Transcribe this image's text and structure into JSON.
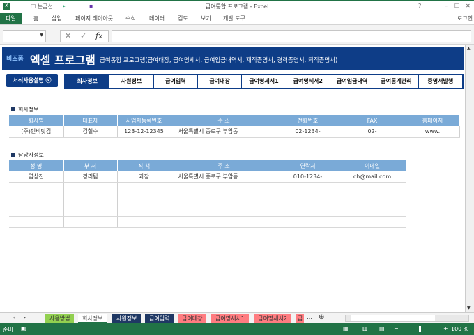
{
  "window": {
    "title": "급여통합 프로그램 - Excel",
    "gridlines_label": "눈금선",
    "help": "?",
    "minimize": "–",
    "maximize": "☐",
    "close": "✕"
  },
  "ribbon": {
    "tabs": [
      "파일",
      "홈",
      "삽입",
      "페이지 레이아웃",
      "수식",
      "데이터",
      "검토",
      "보기",
      "개발 도구"
    ],
    "login": "로그인"
  },
  "formula_bar": {
    "name_box": "",
    "formula": "",
    "fx": "fx"
  },
  "banner": {
    "brand": "비즈폼",
    "title": "엑셀 프로그램",
    "subtitle": "급여통합 프로그램(급여대장, 급여명세서, 급여입금내역서, 재직증명서, 경력증명서, 퇴직증명서)"
  },
  "help_button": "서식사용설명 ⓥ",
  "nav": [
    "회사정보",
    "사원정보",
    "급여입력",
    "급여대장",
    "급여명세서1",
    "급여명세서2",
    "급여입금내역",
    "급여통계관리",
    "증명서발행"
  ],
  "company": {
    "section": "회사정보",
    "headers": [
      "회사명",
      "대표자",
      "사업자등록번호",
      "주 소",
      "전화번호",
      "FAX",
      "홈페이지"
    ],
    "row": [
      "(주)인비닷컴",
      "김철수",
      "123-12-12345",
      "서울특별시 종로구 부암동",
      "02-1234-",
      "02-",
      "www."
    ]
  },
  "contact": {
    "section": "담당자정보",
    "headers": [
      "성 명",
      "부 서",
      "직 책",
      "주 소",
      "연락처",
      "이메일"
    ],
    "row": [
      "염상진",
      "경리팀",
      "과장",
      "서울특별시 종로구 부암동",
      "010-1234-",
      "ch@mail.com"
    ]
  },
  "sheet_tabs": [
    {
      "label": "사용방법",
      "color": "#92d050"
    },
    {
      "label": "회사정보",
      "color": "#f3f3f3"
    },
    {
      "label": "사원정보",
      "color": "#1f3864"
    },
    {
      "label": "급여입력",
      "color": "#1f3864"
    },
    {
      "label": "급여대장",
      "color": "#ff7c80"
    },
    {
      "label": "급여명세서1",
      "color": "#ff7c80"
    },
    {
      "label": "급여명세서2",
      "color": "#ff7c80"
    },
    {
      "label": "급",
      "color": "#ff7c80"
    }
  ],
  "status": {
    "ready": "준비",
    "zoom": "100 %"
  }
}
